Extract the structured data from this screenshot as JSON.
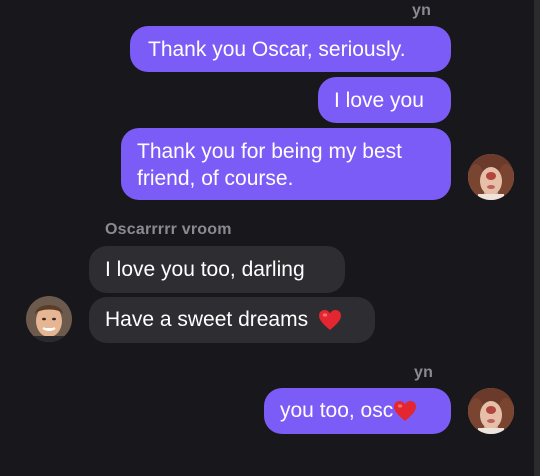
{
  "colors": {
    "background": "#18171b",
    "outgoing_bubble": "#7c5cf7",
    "incoming_bubble": "#2e2d32",
    "label": "#8b8a90",
    "heart": "#e3262f"
  },
  "messages": {
    "group1_sender": "yn",
    "m1": "Thank you Oscar, seriously.",
    "m2": "I love you",
    "m3": "Thank you for being my best friend, of course.",
    "group2_sender": "Oscarrrrr vroom",
    "m4": "I love you too, darling",
    "m5": "Have a sweet dreams",
    "group3_sender": "yn",
    "m6": "you too, osc"
  },
  "icons": {
    "heart": "heart-emoji",
    "avatar_self": "avatar-yn",
    "avatar_other": "avatar-oscar"
  }
}
